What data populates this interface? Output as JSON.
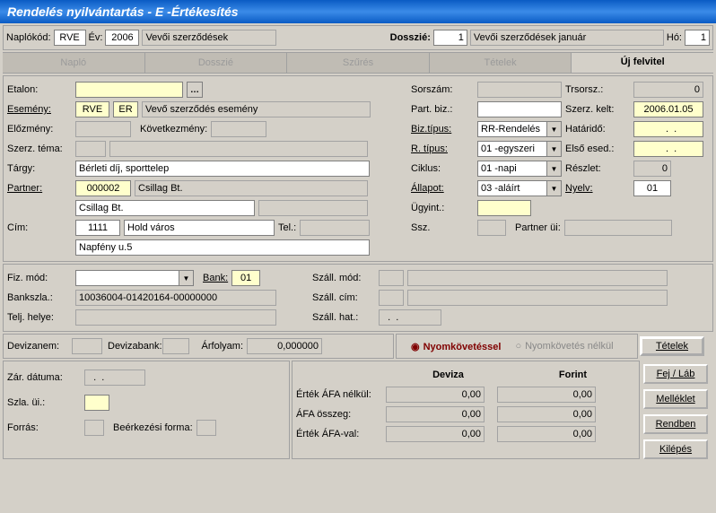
{
  "titlebar": "Rendelés nyilvántartás - E -Értékesítés",
  "ribbon": {
    "naplokod_lbl": "Naplókód:",
    "naplokod": "RVE",
    "ev_lbl": "Év:",
    "ev": "2006",
    "ev_desc": "Vevői szerződések",
    "dosszie_lbl": "Dosszié:",
    "dosszie": "1",
    "dosszie_desc": "Vevői szerződések január",
    "ho_lbl": "Hó:",
    "ho": "1"
  },
  "tabs": [
    "Napló",
    "Dosszié",
    "Szűrés",
    "Tételek",
    "Új felvitel"
  ],
  "main": {
    "etalon_lbl": "Etalon:",
    "esemeny_lbl": "Esemény:",
    "esemeny_code1": "RVE",
    "esemeny_code2": "ER",
    "esemeny_desc": "Vevő szerződés esemény",
    "elozmeny_lbl": "Előzmény:",
    "kovetkezmeny_lbl": "Következmény:",
    "szerz_tema_lbl": "Szerz. téma:",
    "targy_lbl": "Tárgy:",
    "targy": "Bérleti díj, sporttelep",
    "partner_lbl": "Partner:",
    "partner_code": "000002",
    "partner_name": "Csillag Bt.",
    "partner_name2": "Csillag Bt.",
    "cim_lbl": "Cím:",
    "cim_zip": "1111",
    "cim_city": "Hold város",
    "tel_lbl": "Tel.:",
    "cim_addr": "Napfény u.5",
    "sorszam_lbl": "Sorszám:",
    "partbiz_lbl": "Part. biz.:",
    "biztipus_lbl": "Biz.típus:",
    "biztipus": "RR-Rendelés",
    "rtipus_lbl": "R. típus:",
    "rtipus": "01 -egyszeri",
    "ciklus_lbl": "Ciklus:",
    "ciklus": "01 -napi",
    "allapot_lbl": "Állapot:",
    "allapot": "03 -aláírt",
    "ugyint_lbl": "Ügyint.:",
    "ssz_lbl": "Ssz.",
    "partnerui_lbl": "Partner üi:",
    "trsorsz_lbl": "Trsorsz.:",
    "trsorsz": "0",
    "szerzkelt_lbl": "Szerz. kelt:",
    "szerzkelt": "2006.01.05",
    "hatarido_lbl": "Határidő:",
    "hatarido": "  .  .",
    "elsoesed_lbl": "Első esed.:",
    "elsoesed": "  .  .",
    "reszlet_lbl": "Részlet:",
    "reszlet": "0",
    "nyelv_lbl": "Nyelv:",
    "nyelv": "01"
  },
  "fiz": {
    "fizmod_lbl": "Fiz. mód:",
    "bank_lbl": "Bank:",
    "bank": "01",
    "bankszla_lbl": "Bankszla.:",
    "bankszla": "10036004-01420164-00000000",
    "teljhelye_lbl": "Telj. helye:",
    "szallmod_lbl": "Száll. mód:",
    "szallcim_lbl": "Száll. cím:",
    "szallhat_lbl": "Száll. hat.:",
    "szallhat": "  .  ."
  },
  "dev": {
    "devizanem_lbl": "Devizanem:",
    "devizabank_lbl": "Devizabank:",
    "arfolyam_lbl": "Árfolyam:",
    "arfolyam": "0,000000",
    "radio_with": "Nyomkövetéssel",
    "radio_without": "Nyomkövetés nélkül"
  },
  "closing": {
    "zar_lbl": "Zár. dátuma:",
    "zar": "  .  .",
    "szlaui_lbl": "Szla. üi.:",
    "forras_lbl": "Forrás:",
    "beerkezesi_lbl": "Beérkezési forma:"
  },
  "totals": {
    "col_deviza": "Deviza",
    "col_forint": "Forint",
    "row1": "Érték ÁFA nélkül:",
    "row2": "ÁFA összeg:",
    "row3": "Érték ÁFA-val:",
    "d1": "0,00",
    "f1": "0,00",
    "d2": "0,00",
    "f2": "0,00",
    "d3": "0,00",
    "f3": "0,00"
  },
  "buttons": {
    "tetelek": "Tételek",
    "fejlab": "Fej / Láb",
    "melleklet": "Melléklet",
    "rendben": "Rendben",
    "kilepes": "Kilépés"
  }
}
